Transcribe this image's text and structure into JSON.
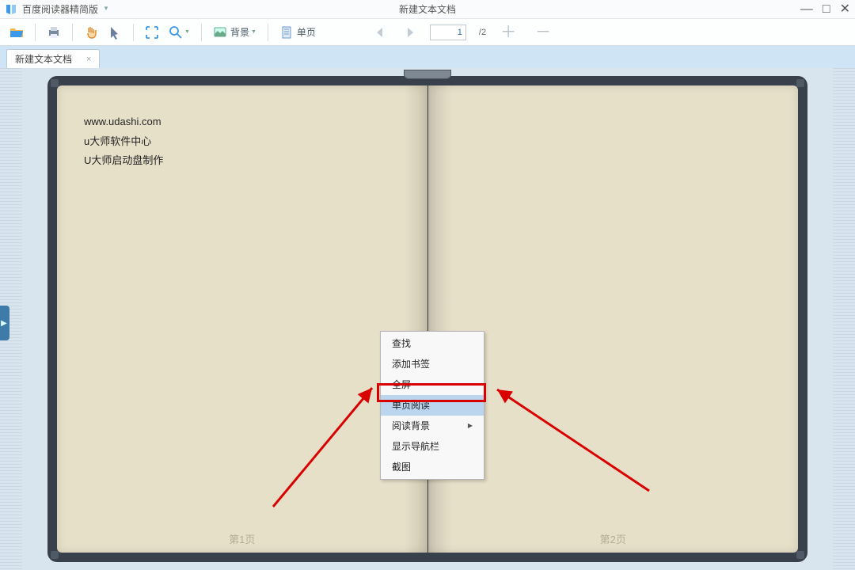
{
  "app": {
    "title": "百度阅读器精简版",
    "doc_title": "新建文本文档"
  },
  "window_controls": {
    "min": "—",
    "max": "□",
    "close": "✕"
  },
  "toolbar": {
    "bg_label": "背景",
    "single_label": "单页",
    "page_current": "1",
    "page_total": "/2"
  },
  "tab": {
    "label": "新建文本文档",
    "close": "×"
  },
  "document": {
    "lines": [
      "www.udashi.com",
      "u大师软件中心",
      "U大师启动盘制作"
    ],
    "page1_label": "第1页",
    "page2_label": "第2页"
  },
  "context_menu": {
    "items": [
      {
        "label": "查找",
        "hover": false,
        "submenu": false
      },
      {
        "label": "添加书签",
        "hover": false,
        "submenu": false
      },
      {
        "label": "全屏",
        "hover": false,
        "submenu": false
      },
      {
        "label": "单页阅读",
        "hover": true,
        "submenu": false
      },
      {
        "label": "阅读背景",
        "hover": false,
        "submenu": true
      },
      {
        "label": "显示导航栏",
        "hover": false,
        "submenu": false
      },
      {
        "label": "截图",
        "hover": false,
        "submenu": false
      }
    ]
  },
  "side_handle": "▶"
}
